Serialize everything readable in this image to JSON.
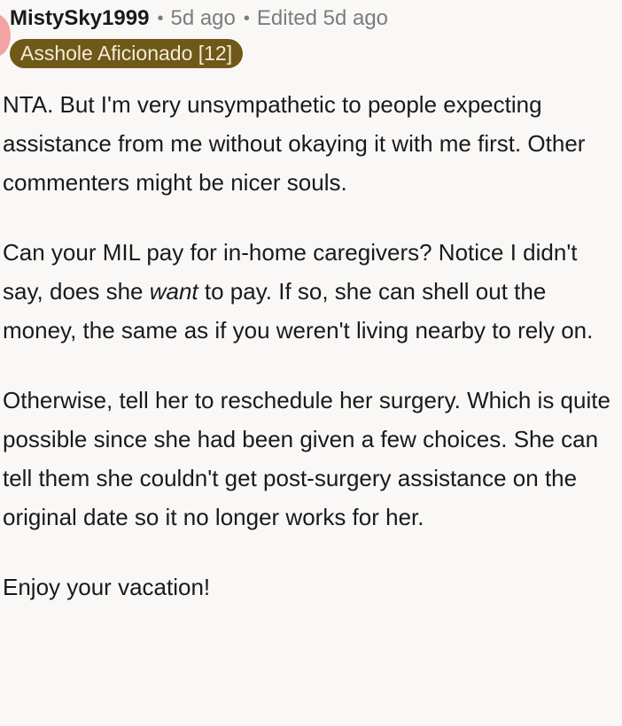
{
  "comment": {
    "author": "MistySky1999",
    "time": "5d ago",
    "edited": "Edited 5d ago",
    "separator": "•",
    "flair": "Asshole Aficionado [12]",
    "paragraphs": {
      "p1": "NTA. But I'm very unsympathetic to people expecting assistance from me without okaying it with me first. Other commenters might be nicer souls.",
      "p2_before": "Can your MIL pay for in-home caregivers? Notice I didn't say, does she ",
      "p2_emphasis": "want",
      "p2_after": " to pay. If so, she can shell out the money, the same as if you weren't living nearby to rely on.",
      "p3": "Otherwise,  tell her to reschedule her surgery. Which is quite possible since she had been given a few choices. She can tell them she couldn't get post-surgery assistance on the original date so it no longer works for her.",
      "p4": "Enjoy your vacation!"
    }
  },
  "colors": {
    "background": "#faf8f6",
    "flair_background": "#6f5818",
    "flair_text": "#f4ecd8",
    "meta_text": "#7c7c7c",
    "avatar": "#f2a3a3"
  }
}
